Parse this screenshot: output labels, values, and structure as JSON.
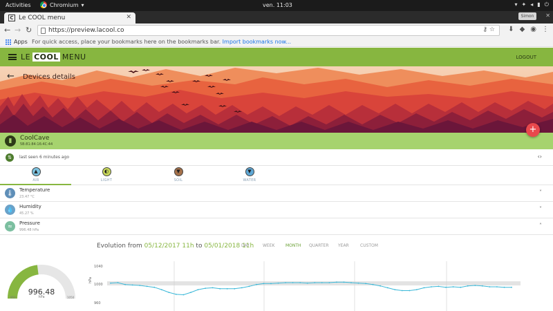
{
  "system": {
    "activities": "Activities",
    "app_name": "Chromium",
    "clock": "ven. 11:03"
  },
  "browser": {
    "tab_title": "Le COOL menu",
    "favicon_letter": "C",
    "url": "https://preview.lacool.co",
    "profile_label": "Simon",
    "bookmarks": {
      "apps_label": "Apps",
      "hint": "For quick access, place your bookmarks here on the bookmarks bar.",
      "import_link": "Import bookmarks now..."
    }
  },
  "app": {
    "logo_left": "LE",
    "logo_box": "COOL",
    "logo_right": "MENU",
    "logout": "LOGOUT",
    "page_title": "Devices details",
    "device": {
      "name": "CoolCave",
      "mac": "5B:81:84:16:4C:44",
      "last_seen": "last seen 6 minutes ago"
    },
    "tabs": [
      {
        "label": "AIR",
        "icon": "air-icon",
        "active": true
      },
      {
        "label": "LIGHT",
        "icon": "light-icon",
        "active": false
      },
      {
        "label": "SOIL",
        "icon": "soil-icon",
        "active": false
      },
      {
        "label": "WATER",
        "icon": "water-icon",
        "active": false
      }
    ],
    "sensors": [
      {
        "label": "Temperature",
        "value": "23.47 °C",
        "icon": "thermometer-icon",
        "chevron": "˅"
      },
      {
        "label": "Humidity",
        "value": "45.27 %",
        "icon": "humidity-icon",
        "chevron": "˅"
      },
      {
        "label": "Pressure",
        "value": "996.48 hPa",
        "icon": "pressure-icon",
        "chevron": "˄"
      }
    ],
    "evolution": {
      "prefix": "Evolution from",
      "from_date": "05/12/2017 11h",
      "connector": "to",
      "to_date": "05/01/2018 11h",
      "ranges": [
        "DAY",
        "WEEK",
        "MONTH",
        "QUARTER",
        "YEAR",
        "CUSTOM"
      ],
      "active_range": "MONTH"
    },
    "gauge": {
      "value": "996.48",
      "unit": "hPa",
      "min_label": "950",
      "max_label": "1050",
      "fraction": 0.46
    },
    "colors": {
      "brand_green": "#87b640",
      "device_green": "#a6d36e",
      "fab_red": "#e9484c",
      "line_blue": "#3bb8d8"
    }
  },
  "chart_data": {
    "type": "line",
    "ylabel": "hPa",
    "yticks": [
      "1040",
      "1000",
      "960"
    ],
    "ylim": [
      960,
      1040
    ],
    "series": [
      {
        "values": [
          1002,
          1003,
          999,
          998,
          997,
          995,
          993,
          988,
          982,
          978,
          977,
          982,
          988,
          991,
          992,
          990,
          990,
          990,
          992,
          995,
          999,
          1001,
          1001,
          1002,
          1003,
          1003,
          1003,
          1002,
          1003,
          1003,
          1003,
          1004,
          1004,
          1003,
          1002,
          1001,
          999,
          996,
          992,
          988,
          986,
          986,
          988,
          992,
          994,
          995,
          993,
          994,
          993,
          996,
          997,
          996,
          994,
          994,
          993,
          993
        ]
      }
    ]
  }
}
